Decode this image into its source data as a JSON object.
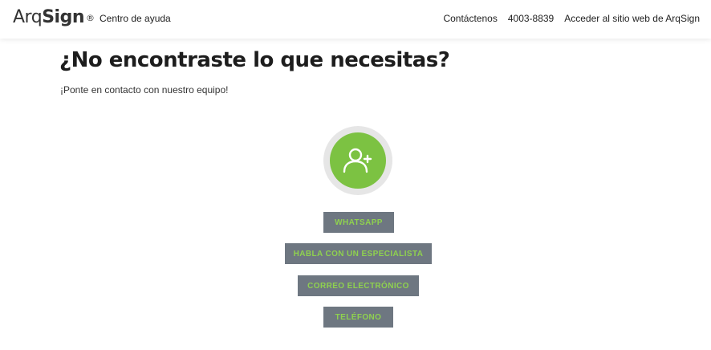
{
  "header": {
    "logo_light": "Arq",
    "logo_bold": "Sign",
    "logo_reg": "®",
    "help_center": "Centro de ayuda",
    "nav": {
      "contact": "Contáctenos",
      "phone": "4003-8839",
      "website": "Acceder al sitio web de ArqSign"
    }
  },
  "main": {
    "title": "¿No encontraste lo que necesitas?",
    "subtitle": "¡Ponte en contacto con nuestro equipo!",
    "avatar_icon": "add-user-icon",
    "buttons": {
      "whatsapp": "WHATSAPP",
      "specialist": "HABLA CON UN ESPECIALISTA",
      "email": "CORREO ELECTRÓNICO",
      "phone": "TELÉFONO"
    }
  },
  "colors": {
    "accent_green": "#7cc242",
    "button_bg": "#6e7781",
    "button_text": "#8fd14f"
  }
}
